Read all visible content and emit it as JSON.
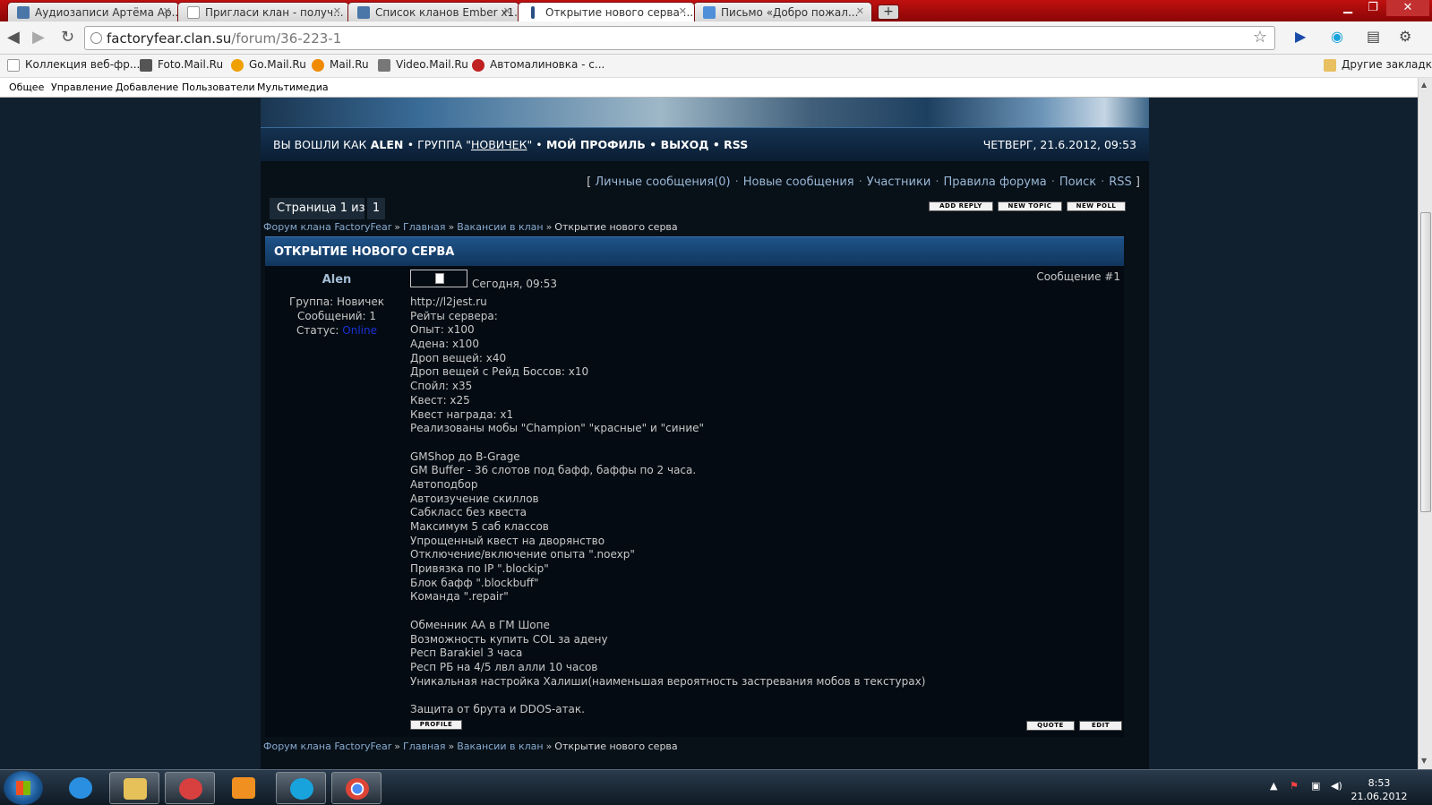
{
  "browser": {
    "tabs": [
      {
        "title": "Аудиозаписи Артёма Ар...",
        "icon": "vk-icon",
        "active": false
      },
      {
        "title": "Пригласи клан - получ...",
        "icon": "page-icon",
        "active": false
      },
      {
        "title": "Список кланов Ember x1...",
        "icon": "vk-icon",
        "active": false
      },
      {
        "title": "Открытие нового серва ...",
        "icon": "forum-icon",
        "active": true
      },
      {
        "title": "Письмо «Добро пожал...",
        "icon": "mail-icon",
        "active": false
      }
    ],
    "url_host": "factoryfear.clan.su",
    "url_path": "/forum/36-223-1",
    "bookmarks": [
      {
        "label": "Коллекция веб-фр...",
        "icon": "page-icon"
      },
      {
        "label": "Foto.Mail.Ru",
        "icon": "camera-icon"
      },
      {
        "label": "Go.Mail.Ru",
        "icon": "search-icon"
      },
      {
        "label": "Mail.Ru",
        "icon": "mail-at-icon"
      },
      {
        "label": "Video.Mail.Ru",
        "icon": "video-icon"
      },
      {
        "label": "Автомалиновка - с...",
        "icon": "car-icon"
      }
    ],
    "other_bookmarks": "Другие закладки",
    "ucoz_menu": [
      "Общее",
      "Управление",
      "Добавление",
      "Пользователи",
      "Мультимедиа"
    ]
  },
  "site": {
    "userbar": {
      "logged_in_as": "ВЫ ВОШЛИ КАК",
      "username": "ALEN",
      "group_label": "• ГРУППА \"",
      "group_name": "НОВИЧЕК",
      "group_close": "\" •",
      "my_profile": "МОЙ ПРОФИЛЬ",
      "logout": "ВЫХОД",
      "rss": "RSS",
      "bullet": "•",
      "datetime": "ЧЕТВЕРГ, 21.6.2012, 09:53"
    },
    "forum_links": {
      "open": "[",
      "close": "]",
      "sep": "·",
      "items": [
        "Личные сообщения(0)",
        "Новые сообщения",
        "Участники",
        "Правила форума",
        "Поиск",
        "RSS"
      ]
    },
    "pager": {
      "text": "Страница 1 из 1",
      "page": "1"
    },
    "buttons": {
      "add_reply": "ADD REPLY",
      "new_topic": "NEW TOPIC",
      "new_poll": "NEW POLL",
      "profile": "PROFILE",
      "quote": "QUOTE",
      "edit": "EDIT"
    },
    "breadcrumb": {
      "forum": "Форум клана FactoryFear",
      "home": "Главная",
      "section": "Вакансии в клан",
      "current": "Открытие нового серва",
      "sep": "»"
    },
    "thread_title": "ОТКРЫТИЕ НОВОГО СЕРВА",
    "post": {
      "author": "Alen",
      "group": "Группа: Новичек",
      "messages": "Сообщений: 1",
      "status_label": "Статус:",
      "status": "Online",
      "date": "Сегодня, 09:53",
      "number": "Сообщение #1",
      "lines": [
        "http://l2jest.ru",
        "Рейты сервера:",
        "Опыт: x100",
        "Адена: x100",
        "Дроп вещей: x40",
        "Дроп вещей с Рейд Боссов: x10",
        "Спойл: x35",
        "Квест: x25",
        "Квест награда: x1",
        "Реализованы мобы \"Champion\" \"красные\" и \"синие\"",
        "",
        "GMShop до B-Grage",
        "GM Buffer - 36 слотов под бафф, баффы по 2 часа.",
        "Автоподбор",
        "Автоизучение скиллов",
        "Сабкласс без квеста",
        "Максимум 5 саб классов",
        "Упрощенный квест на дворянство",
        "Отключение/включение опыта \".noexp\"",
        "Привязка по IP \".blockip\"",
        "Блок бафф \".blockbuff\"",
        "Команда \".repair\"",
        "",
        "Обменник АА в ГМ Шопе",
        "Возможность купить COL за адену",
        "Респ Barakiel 3 часа",
        "Респ РБ на 4/5 лвл алли 10 часов",
        "Уникальная настройка Халиши(наименьшая вероятность застревания мобов в текстурах)",
        "",
        "Защита от брута и DDOS-атак."
      ]
    }
  },
  "taskbar": {
    "time": "8:53",
    "date": "21.06.2012",
    "apps": [
      "internet-explorer",
      "explorer",
      "paint",
      "media-player",
      "skype",
      "chrome"
    ]
  },
  "colors": {
    "tabstrip": "#b00a0a",
    "page_bg": "#10202f",
    "link": "#87abcf",
    "online": "#1a30d8"
  }
}
